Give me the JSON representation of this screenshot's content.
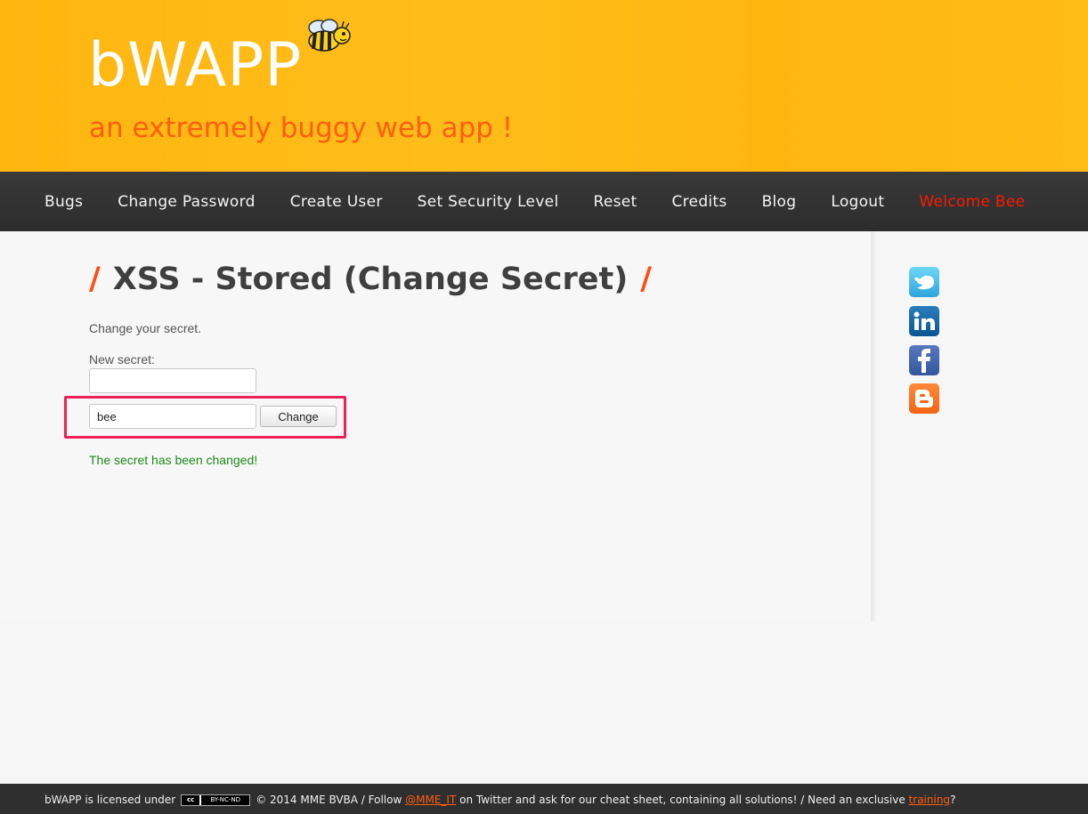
{
  "header": {
    "logo": "bWAPP",
    "tagline": "an extremely buggy web app !"
  },
  "nav": {
    "items": [
      {
        "label": "Bugs"
      },
      {
        "label": "Change Password"
      },
      {
        "label": "Create User"
      },
      {
        "label": "Set Security Level"
      },
      {
        "label": "Reset"
      },
      {
        "label": "Credits"
      },
      {
        "label": "Blog"
      },
      {
        "label": "Logout"
      },
      {
        "label": "Welcome Bee"
      }
    ]
  },
  "main": {
    "title_slash_start": "/",
    "title": "XSS - Stored (Change Secret)",
    "title_slash_end": "/",
    "intro": "Change your secret.",
    "new_secret_label": "New secret:",
    "new_secret_value": "",
    "login_value": "bee",
    "change_button": "Change",
    "success_message": "The secret has been changed!"
  },
  "social": [
    {
      "name": "twitter-icon"
    },
    {
      "name": "linkedin-icon"
    },
    {
      "name": "facebook-icon"
    },
    {
      "name": "blogger-icon"
    }
  ],
  "footer": {
    "text1": "bWAPP is licensed under",
    "cc_label": "cc",
    "cc_text": "BY-NC-ND",
    "text2": "© 2014 MME BVBA / Follow",
    "twitter_link": "@MME_IT",
    "text3": "on Twitter and ask for our cheat sheet, containing all solutions! / Need an exclusive",
    "training_link": "training",
    "text4": "?"
  },
  "colors": {
    "header_bg": "#ffb60f",
    "tagline": "#ff5e10",
    "nav_bg": "#2c2c2c",
    "welcome": "#ff1a00",
    "highlight": "#ee1f5b",
    "success": "#1a8a1a"
  }
}
